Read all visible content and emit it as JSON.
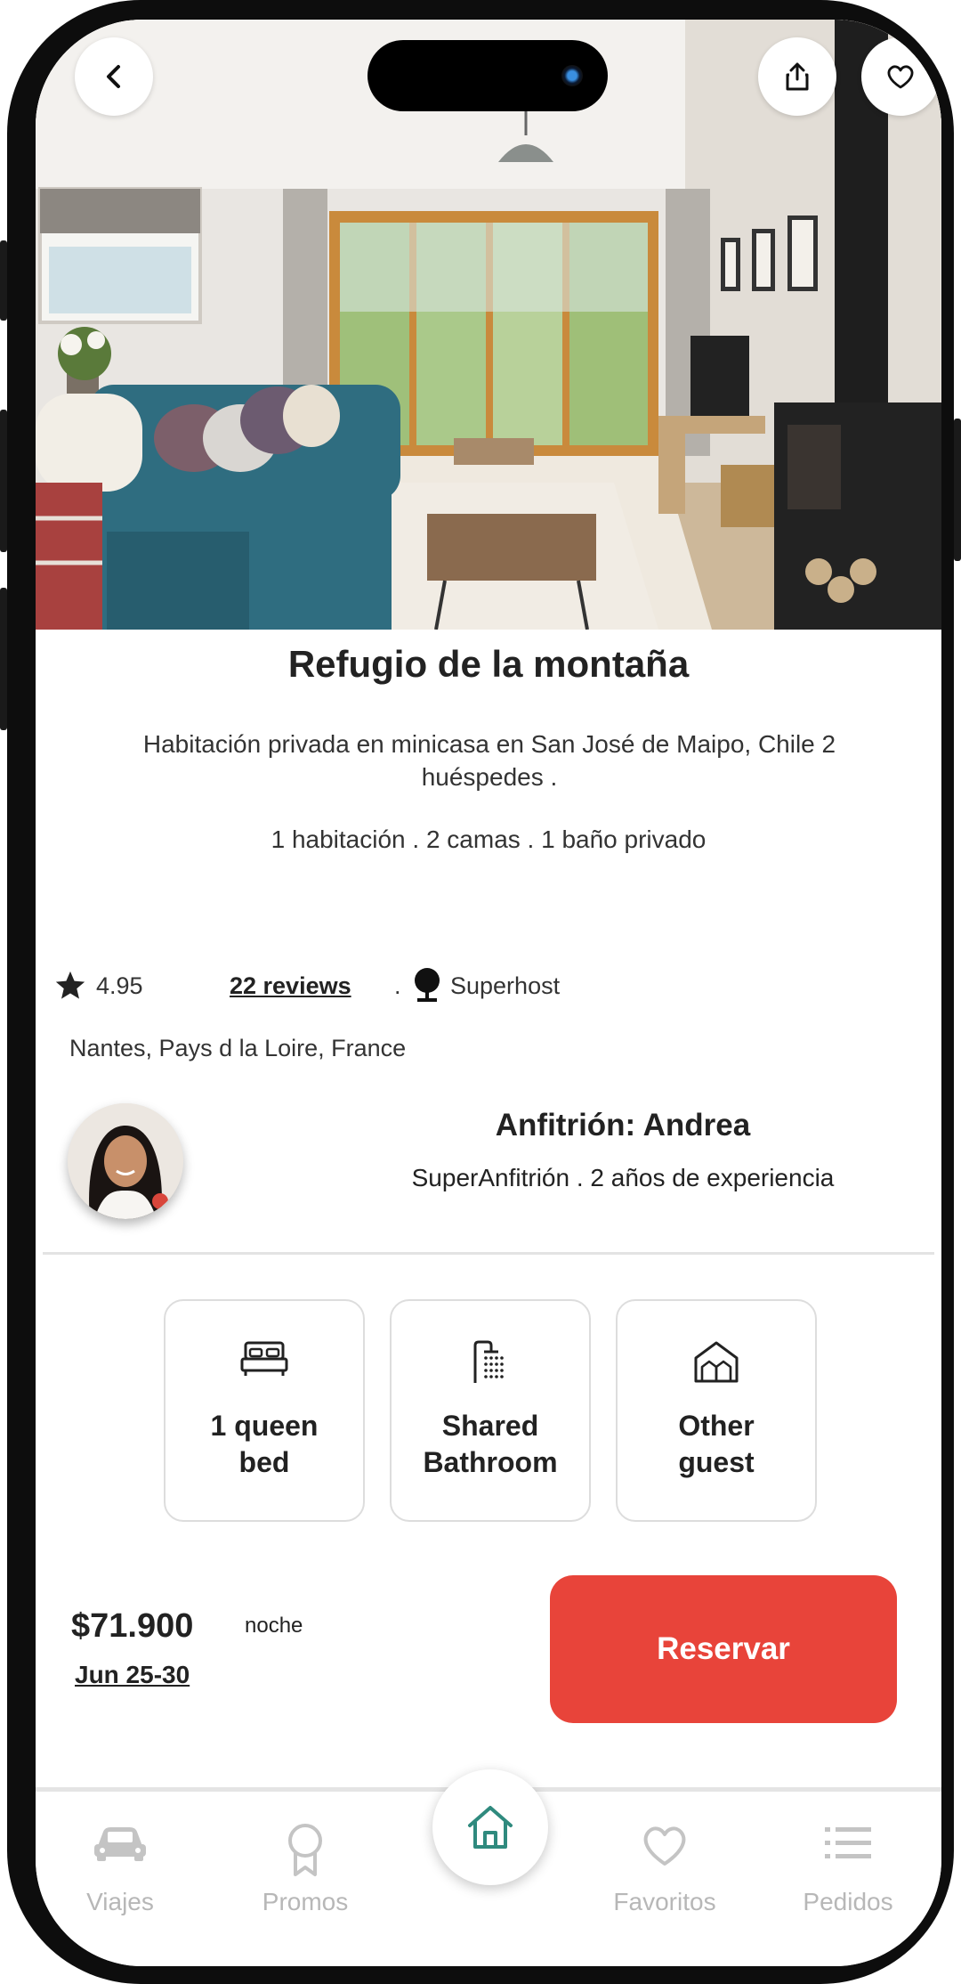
{
  "listing": {
    "title": "Refugio de la montaña",
    "subtitle": "Habitación privada en minicasa en San José de Maipo, Chile 2 huéspedes .",
    "details": "1 habitación . 2 camas . 1 baño privado",
    "rating": "4.95",
    "reviews_link": "22 reviews",
    "separator": ".",
    "superhost_label": "Superhost",
    "location": "Nantes, Pays d la Loire, France"
  },
  "host": {
    "name": "Anfitrión: Andrea",
    "subtitle": "SuperAnfitrión . 2 años de experiencia"
  },
  "amenities": [
    {
      "label_line1": "1 queen",
      "label_line2": "bed",
      "icon": "bed-icon"
    },
    {
      "label_line1": "Shared",
      "label_line2": "Bathroom",
      "icon": "shower-icon"
    },
    {
      "label_line1": "Other",
      "label_line2": "guest",
      "icon": "houses-icon"
    }
  ],
  "booking": {
    "price": "$71.900",
    "per_unit": "noche",
    "dates": "Jun 25-30",
    "reserve_label": "Reservar"
  },
  "nav": {
    "items": [
      {
        "label": "Viajes",
        "icon": "car-icon"
      },
      {
        "label": "Promos",
        "icon": "award-icon"
      },
      {
        "label": "",
        "icon": "home-icon",
        "active": true
      },
      {
        "label": "Favoritos",
        "icon": "heart-icon"
      },
      {
        "label": "Pedidos",
        "icon": "list-icon"
      }
    ]
  },
  "colors": {
    "accent": "#e8443a",
    "home_icon": "#2f8a7e",
    "nav_inactive": "#b7b7b7",
    "text_dark": "#222222"
  }
}
